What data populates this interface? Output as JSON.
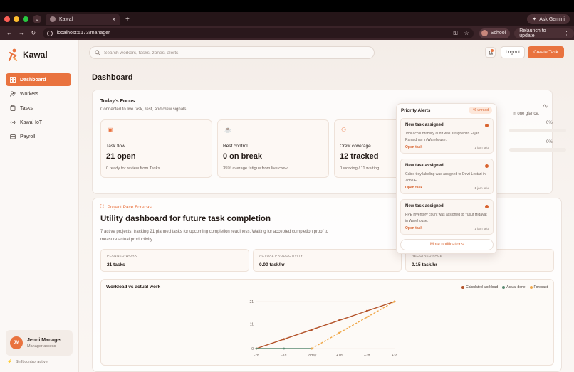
{
  "browser": {
    "tab_title": "Kawal",
    "url": "localhost:5173/manager",
    "gemini_label": "Ask Gemini",
    "profile_label": "School",
    "relaunch_label": "Relaunch to update"
  },
  "app": {
    "brand": "Kawal",
    "search_placeholder": "Search workers, tasks, zones, alerts",
    "logout_label": "Logout",
    "create_task_label": "Create Task",
    "page_title": "Dashboard"
  },
  "sidebar": {
    "items": [
      {
        "label": "Dashboard",
        "icon": "grid-icon",
        "active": true
      },
      {
        "label": "Workers",
        "icon": "users-icon"
      },
      {
        "label": "Tasks",
        "icon": "clipboard-icon"
      },
      {
        "label": "Kawal IoT",
        "icon": "wireless-icon"
      },
      {
        "label": "Payroll",
        "icon": "wallet-icon"
      }
    ],
    "user": {
      "initials": "JM",
      "name": "Jenni Manager",
      "role": "Manager access"
    },
    "shift_status": "Shift control active"
  },
  "focus": {
    "title": "Today's Focus",
    "subtitle": "Connected to live task, rest, and crew signals.",
    "metrics": [
      {
        "label": "Task flow",
        "value": "21 open",
        "note": "0 ready for review from Tasks."
      },
      {
        "label": "Rest control",
        "value": "0 on break",
        "note": "35% average fatigue from live crew."
      },
      {
        "label": "Crew coverage",
        "value": "12 tracked",
        "note": "0 working / 11 waiting."
      }
    ],
    "side_text": "in one glance.",
    "side_pct_1": "0%",
    "side_pct_2": "0%"
  },
  "project": {
    "tag": "Project Pace Forecast",
    "title": "Utility dashboard for future task completion",
    "description": "7 active projects: tracking 21 planned tasks for upcoming completion readiness. Waiting for accepted completion proof to measure actual productivity.",
    "stats": [
      {
        "key": "PLANNED WORK",
        "value": "21 tasks"
      },
      {
        "key": "ACTUAL PRODUCTIVITY",
        "value": "0.00 task/hr"
      },
      {
        "key": "REQUIRED PACE",
        "value": "0.15 task/hr"
      }
    ]
  },
  "chart_data": {
    "type": "line",
    "title": "Workload vs actual work",
    "categories": [
      "-2d",
      "-1d",
      "Today",
      "+1d",
      "+2d",
      "+3d"
    ],
    "y_ticks": [
      "0",
      "11",
      "21"
    ],
    "ylim": [
      0,
      21
    ],
    "legend_position": "top-right",
    "series": [
      {
        "name": "Calculated workload",
        "color": "#b4532a",
        "values": [
          0,
          4.2,
          8.4,
          12.6,
          16.8,
          21
        ]
      },
      {
        "name": "Actual done",
        "color": "#5b8a72",
        "values": [
          0,
          0,
          0,
          null,
          null,
          null
        ]
      },
      {
        "name": "Forecast",
        "color": "#f0a84a",
        "values": [
          null,
          null,
          0,
          7,
          14,
          21
        ]
      }
    ]
  },
  "notifications": {
    "title": "Priority Alerts",
    "badge": "46 unread",
    "items": [
      {
        "title": "New task assigned",
        "desc": "Tool accountability audit was assigned to Fajar Ramadhan in Warehouse.",
        "action": "Open task",
        "time": "1 jam lalu"
      },
      {
        "title": "New task assigned",
        "desc": "Cable tray labeling was assigned to Dewi Lestari in Zone E.",
        "action": "Open task",
        "time": "1 jam lalu"
      },
      {
        "title": "New task assigned",
        "desc": "PPE inventory count was assigned to Yusuf Hidayat in Warehouse.",
        "action": "Open task",
        "time": "1 jam lalu"
      }
    ],
    "more_label": "More notifications"
  },
  "colors": {
    "accent": "#e9733f",
    "workload": "#b4532a",
    "actual": "#5b8a72",
    "forecast": "#f0a84a"
  }
}
